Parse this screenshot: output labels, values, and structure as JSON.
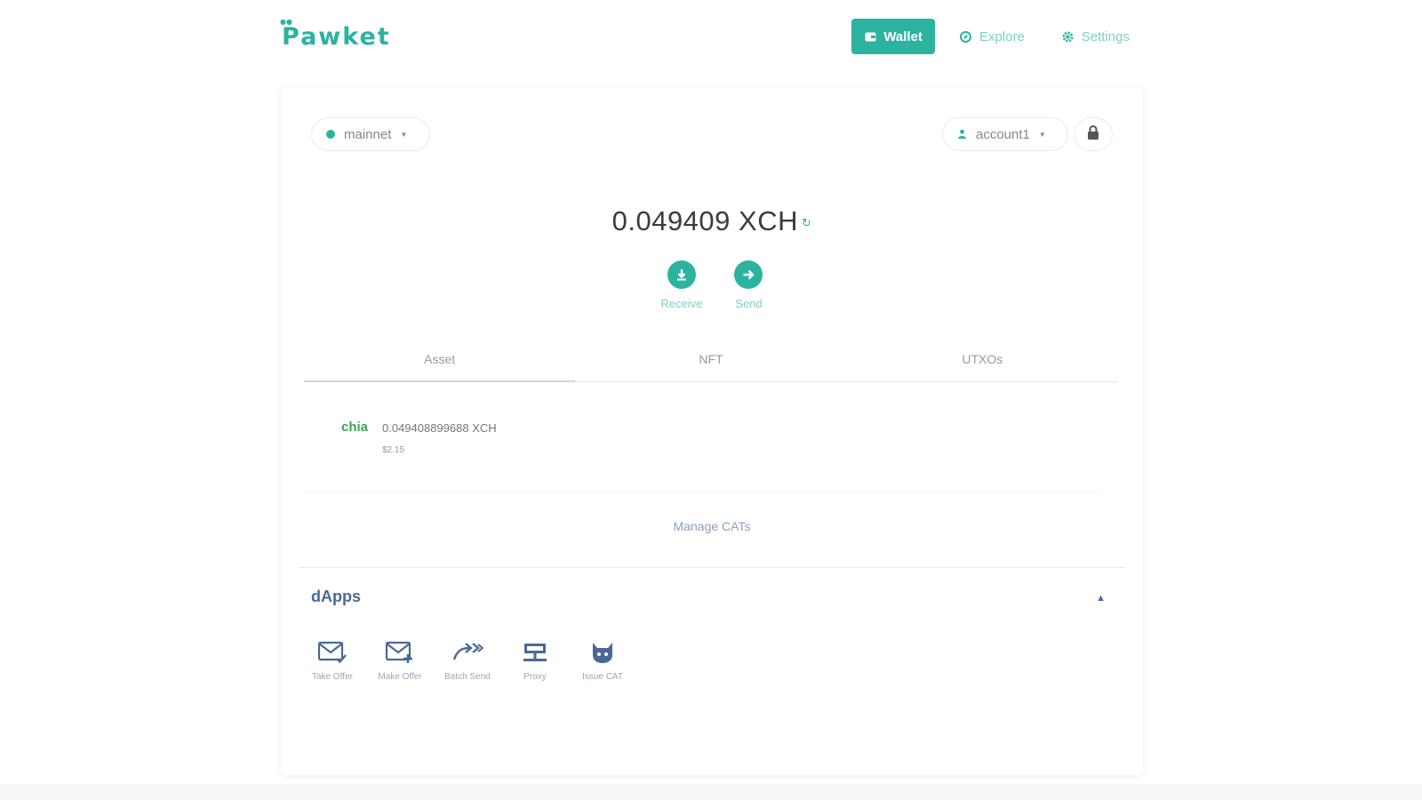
{
  "header": {
    "logo": "Pawket",
    "nav": [
      {
        "label": "Wallet",
        "icon": "wallet-icon",
        "active": true
      },
      {
        "label": "Explore",
        "icon": "compass-icon"
      },
      {
        "label": "Settings",
        "icon": "gear-icon"
      }
    ]
  },
  "network": {
    "label": "mainnet"
  },
  "account": {
    "label": "account1"
  },
  "balance": {
    "amount": "0.049409 XCH"
  },
  "actions": [
    {
      "label": "Receive",
      "icon": "download-icon"
    },
    {
      "label": "Send",
      "icon": "arrow-right-icon"
    }
  ],
  "tabs": [
    {
      "label": "Asset",
      "active": true
    },
    {
      "label": "NFT"
    },
    {
      "label": "UTXOs"
    }
  ],
  "assets": [
    {
      "logo": "chia",
      "amount": "0.049408899688 XCH",
      "usd": "$2.15"
    }
  ],
  "manage_cats": "Manage CATs",
  "dapps": {
    "title": "dApps",
    "items": [
      {
        "label": "Take Offer",
        "icon": "mail-check-icon"
      },
      {
        "label": "Make Offer",
        "icon": "mail-plus-icon"
      },
      {
        "label": "Batch Send",
        "icon": "batch-send-icon"
      },
      {
        "label": "Proxy",
        "icon": "network-icon"
      },
      {
        "label": "Issue CAT",
        "icon": "cat-icon"
      }
    ]
  },
  "colors": {
    "accent": "#2bb3a0",
    "dapp": "#4a6a94",
    "chia": "#3aa655"
  }
}
